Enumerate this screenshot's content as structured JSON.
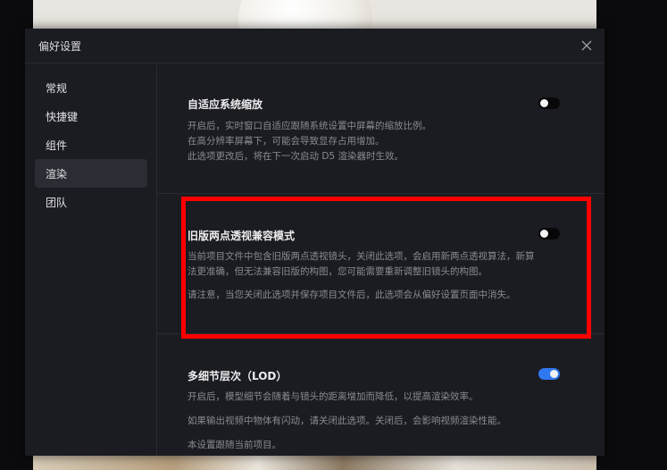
{
  "dialog": {
    "title": "偏好设置"
  },
  "sidebar": {
    "items": [
      {
        "label": "常规",
        "active": false
      },
      {
        "label": "快捷键",
        "active": false
      },
      {
        "label": "组件",
        "active": false
      },
      {
        "label": "渲染",
        "active": true
      },
      {
        "label": "团队",
        "active": false
      }
    ]
  },
  "settings": {
    "adaptive_scaling": {
      "title": "自适应系统缩放",
      "enabled": false,
      "desc_lines": [
        "开启后，实时窗口自适应跟随系统设置中屏幕的缩放比例。",
        "在高分辨率屏幕下，可能会导致显存占用增加。",
        "此选项更改后，将在下一次启动 D5 渲染器时生效。"
      ]
    },
    "legacy_two_point": {
      "title": "旧版两点透视兼容模式",
      "enabled": false,
      "desc_lines": [
        "当前项目文件中包含旧版两点透视镜头，关闭此选项，会启用新两点透视算法，新算",
        "法更准确，但无法兼容旧版的构图，您可能需要重新调整旧镜头的构图。"
      ],
      "note": "请注意，当您关闭此选项并保存项目文件后，此选项会从偏好设置页面中消失。"
    },
    "lod": {
      "title": "多细节层次（LOD）",
      "enabled": true,
      "desc_1": "开启后，模型细节会随着与镜头的距离增加而降低，以提高渲染效率。",
      "desc_2": "如果输出视频中物体有闪动，请关闭此选项。关闭后，会影响视频渲染性能。",
      "desc_3": "本设置跟随当前项目。"
    }
  },
  "colors": {
    "dialog_bg": "#1b1c21",
    "toggle_on": "#2f78ef",
    "highlight": "#ff0000"
  }
}
